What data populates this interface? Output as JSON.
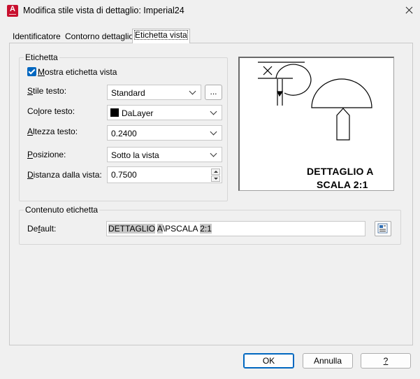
{
  "window": {
    "title": "Modifica stile vista di dettaglio: Imperial24",
    "app_icon_letter": "A"
  },
  "tabs": [
    {
      "label": "Identificatore"
    },
    {
      "label": "Contorno dettaglio"
    },
    {
      "label": "Etichetta vista"
    }
  ],
  "etichetta": {
    "legend": "Etichetta",
    "show_label": {
      "label_rest": "ostra etichetta vista",
      "label_key": "M",
      "checked": true
    },
    "stile_testo": {
      "label_key": "S",
      "label_rest": "tile testo:",
      "value": "Standard",
      "browse_label": "..."
    },
    "colore_testo": {
      "label_key": "l",
      "label_pre": "Co",
      "label_rest": "ore testo:",
      "value": "DaLayer",
      "swatch_color": "#000000"
    },
    "altezza_testo": {
      "label_key": "A",
      "label_rest": "ltezza testo:",
      "value": "0.2400"
    },
    "posizione": {
      "label_key": "P",
      "label_rest": "osizione:",
      "value": "Sotto la vista"
    },
    "distanza": {
      "label_key": "D",
      "label_rest": "istanza dalla vista:",
      "value": "0.7500"
    }
  },
  "preview": {
    "line1": "DETTAGLIO A",
    "line2": "SCALA 2:1"
  },
  "contenuto": {
    "legend": "Contenuto etichetta",
    "default_label_key": "f",
    "default_label_pre": "De",
    "default_label_rest": "ault:",
    "value_parts": [
      {
        "text": "DETTAGLIO",
        "selected": true
      },
      {
        "text": " ",
        "selected": false
      },
      {
        "text": "A",
        "selected": true
      },
      {
        "text": "\\PSCALA ",
        "selected": false
      },
      {
        "text": "2:1",
        "selected": true
      }
    ]
  },
  "footer": {
    "ok": "OK",
    "cancel": "Annulla",
    "help": "?"
  },
  "colors": {
    "accent": "#0067c0",
    "app_icon": "#c8102e",
    "selection": "#c8c8c8"
  }
}
